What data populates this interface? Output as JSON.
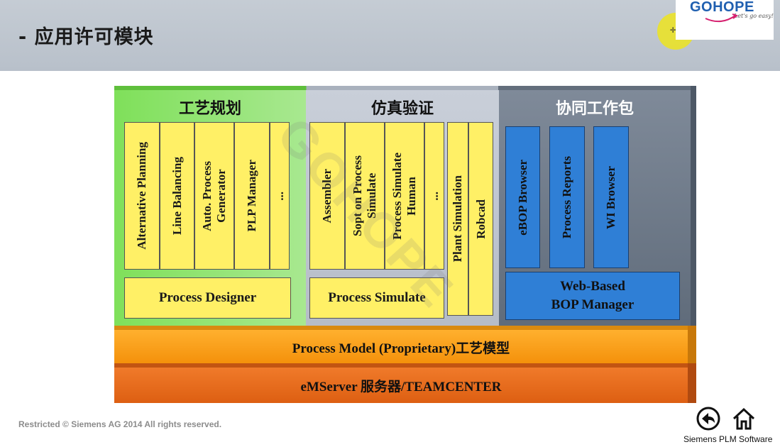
{
  "header": {
    "title": "- 应用许可模块",
    "logo": {
      "text": "GOHOPE",
      "tagline": "Let's go easy!"
    }
  },
  "diagram": {
    "sections": [
      {
        "title": "工艺规划",
        "modules": [
          "Alternative Planning",
          "Line Balancing",
          "Auto. Process\nGenerator",
          "PLP Manager",
          "..."
        ],
        "base": "Process Designer"
      },
      {
        "title": "仿真验证",
        "modules": [
          "Assembler",
          "Sopt on Process\nSimulate",
          "Process Simulate\nHuman",
          "..."
        ],
        "base": "Process Simulate",
        "extra_modules": [
          "Plant Simulation",
          "Robcad"
        ]
      },
      {
        "title": "协同工作包",
        "modules": [
          "eBOP Browser",
          "Process Reports",
          "WI Browser"
        ],
        "base": "Web-Based\nBOP Manager"
      }
    ],
    "layers": [
      "Process Model (Proprietary)工艺模型",
      "eMServer 服务器/TEAMCENTER"
    ],
    "watermark": "GOHOPE"
  },
  "footer": {
    "copyright": "Restricted © Siemens AG 2014 All rights reserved.",
    "brand": "Siemens PLM Software",
    "icons": [
      "back-icon",
      "home-icon"
    ]
  },
  "colors": {
    "planning_panel": "#8fe26a",
    "simulation_panel": "#c2c9d3",
    "collab_panel": "#6f7a89",
    "module_yellow": "#fff066",
    "module_blue": "#2f7fd6",
    "layer_orange": "#f9a21e",
    "layer_red": "#e86a1c"
  }
}
